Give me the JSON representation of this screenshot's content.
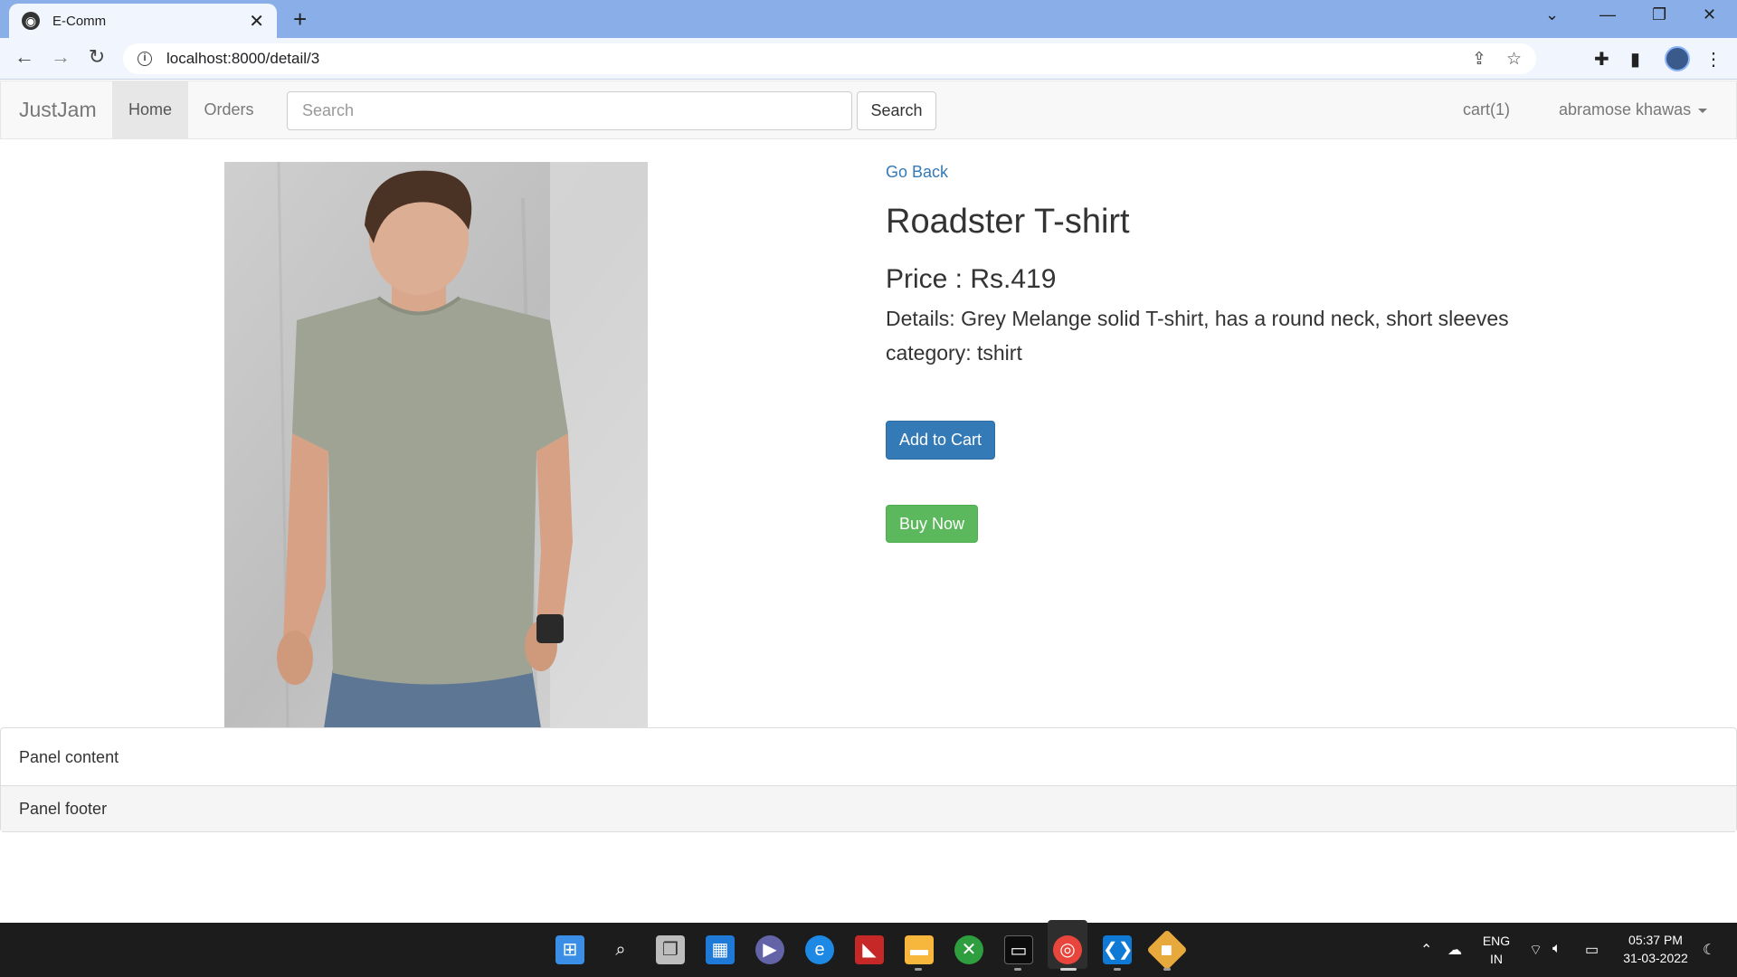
{
  "browser": {
    "tab_title": "E-Comm",
    "url": "localhost:8000/detail/3"
  },
  "navbar": {
    "brand": "JustJam",
    "items": [
      {
        "label": "Home",
        "active": true
      },
      {
        "label": "Orders",
        "active": false
      }
    ],
    "search_placeholder": "Search",
    "search_button": "Search",
    "cart": "cart(1)",
    "user": "abramose khawas"
  },
  "product": {
    "go_back": "Go Back",
    "name": "Roadster T-shirt",
    "price": "Price : Rs.419",
    "details": "Details: Grey Melange solid T-shirt, has a round neck, short sleeves",
    "category": "category: tshirt",
    "add_to_cart": "Add to Cart",
    "buy_now": "Buy Now"
  },
  "panel": {
    "content": "Panel content",
    "footer": "Panel footer"
  },
  "taskbar": {
    "language": "ENG",
    "region": "IN",
    "time": "05:37 PM",
    "date": "31-03-2022",
    "apps": [
      "windows-start",
      "search",
      "task-view",
      "widgets",
      "teams-chat",
      "edge",
      "app-red",
      "file-explorer",
      "xbox",
      "terminal",
      "chrome",
      "vscode",
      "git"
    ]
  },
  "colors": {
    "tabbar": "#8aaee8",
    "primary_button": "#337ab7",
    "success_button": "#5cb85c",
    "link": "#337ab7"
  }
}
